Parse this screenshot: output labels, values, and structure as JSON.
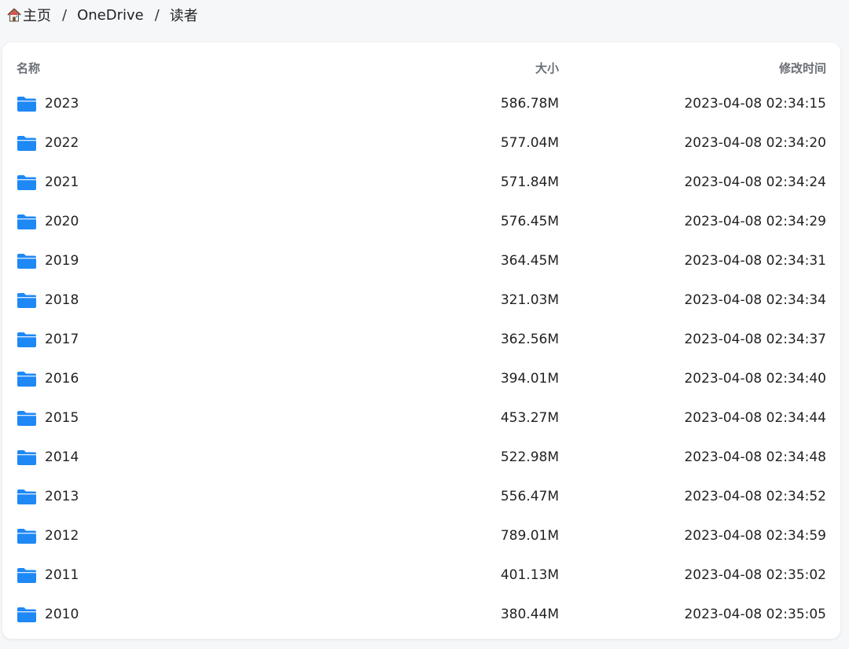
{
  "breadcrumb": {
    "home_label": "主页",
    "separator": "/",
    "items": [
      "OneDrive",
      "读者"
    ]
  },
  "table": {
    "headers": {
      "name": "名称",
      "size": "大小",
      "modified": "修改时间"
    },
    "folder_icon_color": "#1e88f5",
    "rows": [
      {
        "name": "2023",
        "size": "586.78M",
        "modified": "2023-04-08 02:34:15"
      },
      {
        "name": "2022",
        "size": "577.04M",
        "modified": "2023-04-08 02:34:20"
      },
      {
        "name": "2021",
        "size": "571.84M",
        "modified": "2023-04-08 02:34:24"
      },
      {
        "name": "2020",
        "size": "576.45M",
        "modified": "2023-04-08 02:34:29"
      },
      {
        "name": "2019",
        "size": "364.45M",
        "modified": "2023-04-08 02:34:31"
      },
      {
        "name": "2018",
        "size": "321.03M",
        "modified": "2023-04-08 02:34:34"
      },
      {
        "name": "2017",
        "size": "362.56M",
        "modified": "2023-04-08 02:34:37"
      },
      {
        "name": "2016",
        "size": "394.01M",
        "modified": "2023-04-08 02:34:40"
      },
      {
        "name": "2015",
        "size": "453.27M",
        "modified": "2023-04-08 02:34:44"
      },
      {
        "name": "2014",
        "size": "522.98M",
        "modified": "2023-04-08 02:34:48"
      },
      {
        "name": "2013",
        "size": "556.47M",
        "modified": "2023-04-08 02:34:52"
      },
      {
        "name": "2012",
        "size": "789.01M",
        "modified": "2023-04-08 02:34:59"
      },
      {
        "name": "2011",
        "size": "401.13M",
        "modified": "2023-04-08 02:35:02"
      },
      {
        "name": "2010",
        "size": "380.44M",
        "modified": "2023-04-08 02:35:05"
      }
    ]
  }
}
